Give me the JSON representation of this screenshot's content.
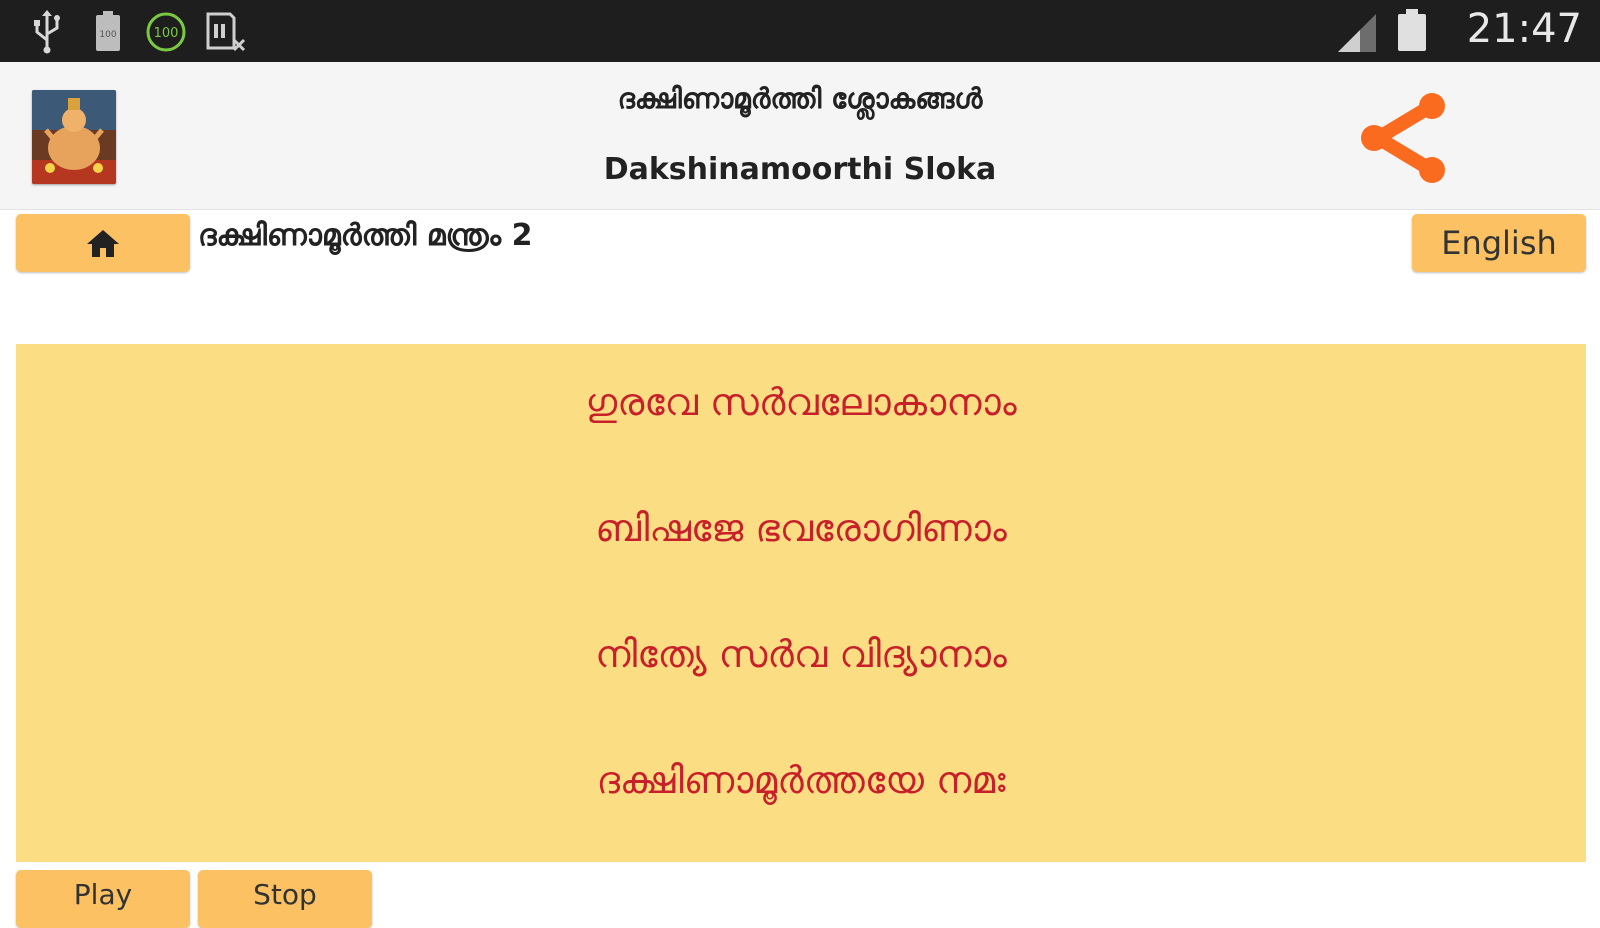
{
  "status_bar": {
    "icons": [
      "usb-icon",
      "battery-saver-icon",
      "battery-100-icon",
      "sd-card-icon",
      "signal-icon",
      "battery-icon"
    ],
    "battery_badge": "100",
    "time": "21:47"
  },
  "header": {
    "title_malayalam": "ദക്ഷിണാമൂർത്തി ശ്ലോകങ്ങൾ",
    "title_english": "Dakshinamoorthi Sloka",
    "share_icon": "share-icon",
    "thumbnail_icon": "deity-thumbnail"
  },
  "toolbar": {
    "home_icon": "home-icon",
    "mantra_title": "ദക്ഷിണാമൂർത്തി മന്ത്രം 2",
    "language_button": "English"
  },
  "verse": {
    "lines": [
      "ഗുരവേ സർവലോകാനാം",
      "ബിഷജേ ഭവരോഗിണാം",
      "നിത്യേ സർവ വിദ്യാനാം",
      "ദക്ഷിണാമൂർത്തയേ നമഃ"
    ]
  },
  "controls": {
    "play_label": "Play",
    "stop_label": "Stop"
  },
  "colors": {
    "accent_orange": "#fb6b1f",
    "button_orange": "#fbc163",
    "verse_background": "#fbdd83",
    "verse_text": "#c8202a",
    "status_bar": "#1e1e1e"
  }
}
